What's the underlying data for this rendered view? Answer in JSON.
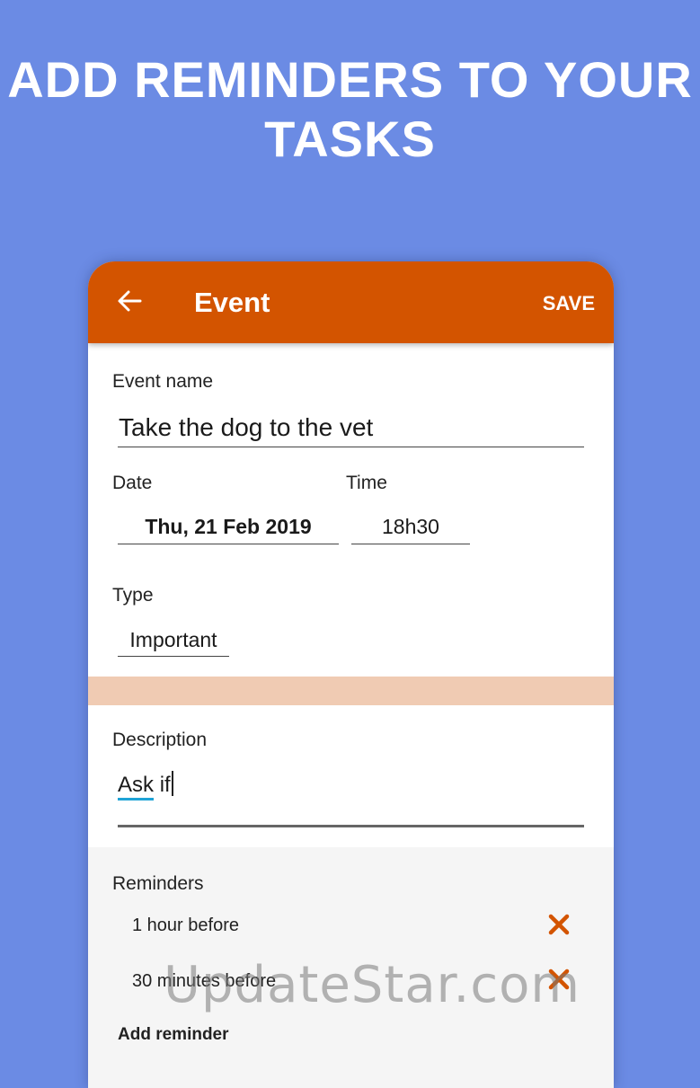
{
  "headline": {
    "line1": "ADD REMINDERS TO YOUR",
    "line2": "TASKS"
  },
  "appbar": {
    "title": "Event",
    "save_label": "SAVE",
    "back_icon": "arrow-left-icon"
  },
  "form": {
    "event_name_label": "Event name",
    "event_name_value": "Take the dog to the vet",
    "date_label": "Date",
    "date_value": "Thu, 21 Feb 2019",
    "time_label": "Time",
    "time_value": "18h30",
    "type_label": "Type",
    "type_value": "Important",
    "description_label": "Description",
    "description_value_word1": "Ask",
    "description_value_word2": "if"
  },
  "reminders": {
    "label": "Reminders",
    "items": [
      {
        "text": "1 hour before",
        "remove_icon": "close-icon"
      },
      {
        "text": "30 minutes before",
        "remove_icon": "close-icon"
      }
    ],
    "add_label": "Add reminder"
  },
  "watermark": "UpdateStar.com",
  "colors": {
    "background": "#6b8be4",
    "appbar": "#d35400",
    "divider": "#f0cbb3",
    "accent_remove": "#d35400",
    "spellcheck_underline": "#1fa3d6"
  }
}
